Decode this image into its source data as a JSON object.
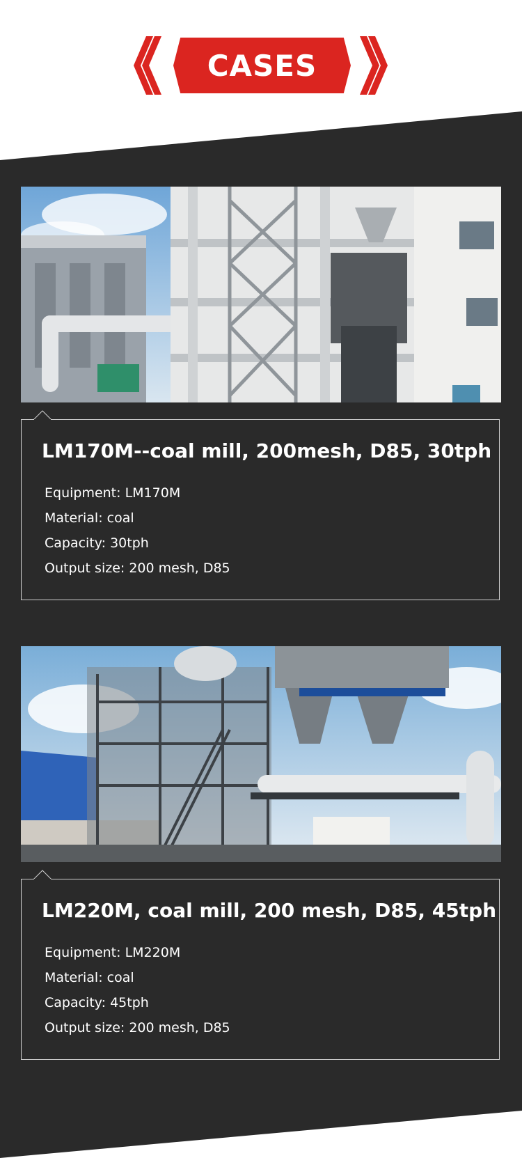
{
  "header": {
    "title": "CASES",
    "accent_color": "#db2520"
  },
  "section_background": "#2a2a2a",
  "cases": [
    {
      "photo": "coal-mill-plant-photo",
      "title": "LM170M--coal mill, 200mesh, D85, 30tph",
      "specs": [
        "Equipment: LM170M",
        "Material: coal",
        "Capacity: 30tph",
        "Output size: 200 mesh, D85"
      ]
    },
    {
      "photo": "coal-mill-plant-photo",
      "title": "LM220M, coal mill, 200 mesh, D85, 45tph",
      "specs": [
        "Equipment: LM220M",
        "Material: coal",
        "Capacity: 45tph",
        "Output size: 200 mesh, D85"
      ]
    }
  ]
}
